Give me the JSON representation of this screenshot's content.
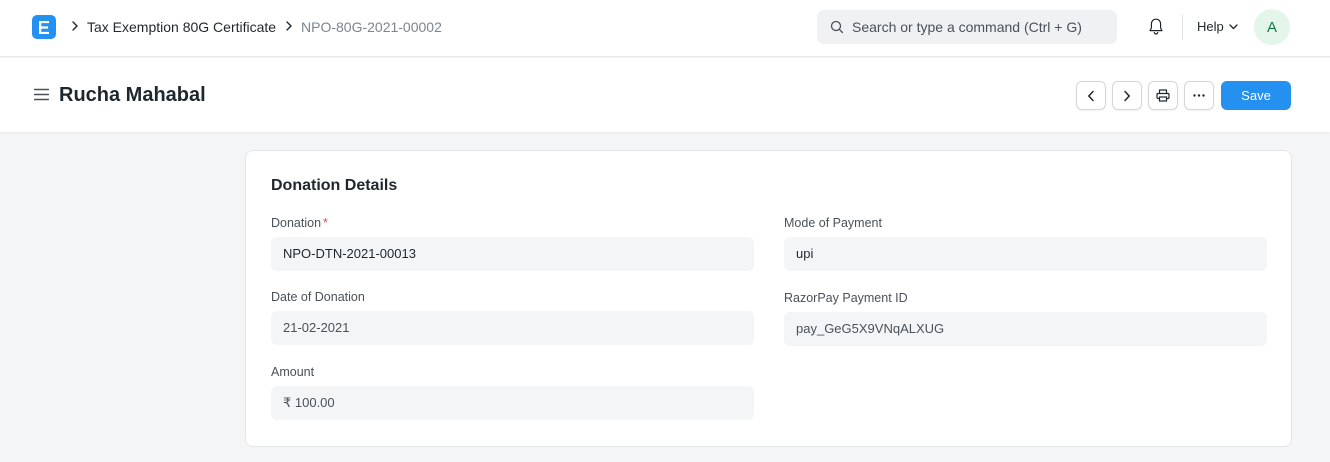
{
  "navbar": {
    "logo_letter": "E",
    "breadcrumbs": [
      "Tax Exemption 80G Certificate",
      "NPO-80G-2021-00002"
    ],
    "search_placeholder": "Search or type a command (Ctrl + G)",
    "help_label": "Help",
    "avatar_initial": "A"
  },
  "header": {
    "title": "Rucha Mahabal",
    "save_label": "Save"
  },
  "form": {
    "section_title": "Donation Details",
    "fields": {
      "donation": {
        "label": "Donation",
        "value": "NPO-DTN-2021-00013",
        "required": "*"
      },
      "mode_of_payment": {
        "label": "Mode of Payment",
        "value": "upi"
      },
      "date_of_donation": {
        "label": "Date of Donation",
        "value": "21-02-2021"
      },
      "razorpay_payment_id": {
        "label": "RazorPay Payment ID",
        "value": "pay_GeG5X9VNqALXUG"
      },
      "amount": {
        "label": "Amount",
        "value": "₹ 100.00"
      }
    }
  },
  "colors": {
    "primary": "#2490ef",
    "required": "#e24c4c",
    "avatar_bg": "#e4f5e9",
    "avatar_fg": "#16794c"
  },
  "icons": {
    "logo": "erpnext-logo-icon",
    "breadcrumb_separator": "chevron-right-icon",
    "search": "search-icon",
    "notifications": "bell-icon",
    "help_dropdown": "chevron-down-icon",
    "sidebar_toggle": "hamburger-icon",
    "previous": "chevron-left-icon",
    "next": "chevron-right-icon",
    "print": "printer-icon",
    "more": "more-horizontal-icon"
  }
}
